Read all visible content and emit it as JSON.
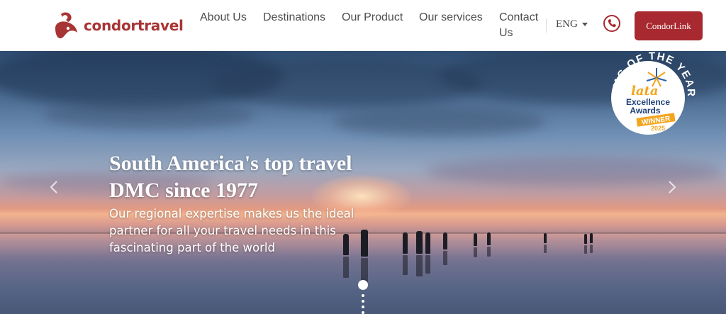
{
  "header": {
    "logo_text": "condortravel",
    "nav": [
      {
        "label": "About Us"
      },
      {
        "label": "Destinations"
      },
      {
        "label": "Our Product"
      },
      {
        "label": "Our services"
      },
      {
        "label": "Contact Us"
      }
    ],
    "language": "ENG",
    "cta_label": "CondorLink",
    "brand_color": "#a8292f"
  },
  "hero": {
    "headline": "South America's top travel DMC since 1977",
    "subtext": "Our regional expertise makes us the ideal partner for all your travel needs in this fascinating part of the world",
    "slide_indicator": {
      "active_index": 0
    }
  },
  "badge": {
    "arc_text": "DMC OF THE YEAR",
    "brand": "lata",
    "line1": "Excellence",
    "line2": "Awards",
    "ribbon": "WINNER",
    "year": "2025"
  },
  "icons": [
    "condor-logo-icon",
    "chevron-down-icon",
    "phone-icon",
    "chevron-left-icon",
    "chevron-right-icon"
  ]
}
